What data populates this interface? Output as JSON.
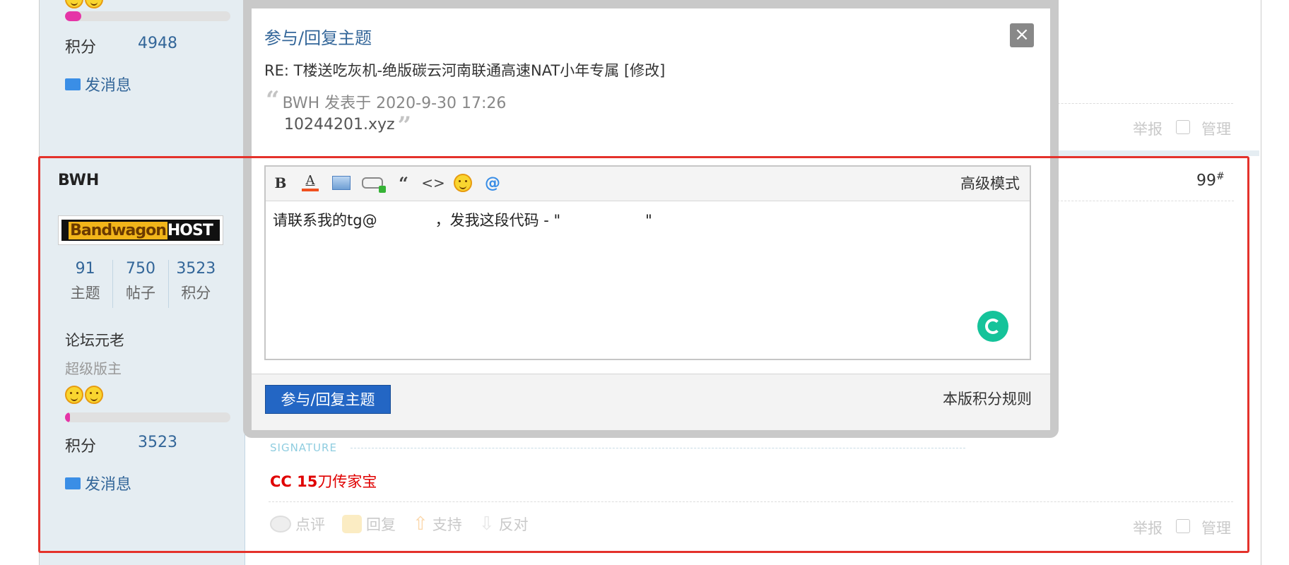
{
  "prev_post": {
    "score_label": "积分",
    "score_value": "4948",
    "message_link": "发消息",
    "report": "举报",
    "manage": "管理",
    "progress": 0.1
  },
  "post": {
    "username": "BWH",
    "logo_text": "BandwagonHOST",
    "stats": [
      {
        "value": "91",
        "label": "主题"
      },
      {
        "value": "750",
        "label": "帖子"
      },
      {
        "value": "3523",
        "label": "积分"
      }
    ],
    "rank": "论坛元老",
    "group": "超级版主",
    "progress": 0.02,
    "score_label": "积分",
    "score_value": "3523",
    "message_link": "发消息",
    "floor_number": "99",
    "floor_symbol": "#",
    "signature_label": "SIGNATURE",
    "signature_bold": "CC 15",
    "signature_rest": "刀传家宝",
    "actions": {
      "comment": "点评",
      "reply": "回复",
      "support": "支持",
      "oppose": "反对"
    },
    "report": "举报",
    "manage": "管理"
  },
  "modal": {
    "title": "参与/回复主题",
    "close": "×",
    "subject": "RE: T楼送吃灰机-绝版碳云河南联通高速NAT小年专属 [修改]",
    "quote_line1": "BWH 发表于 2020-9-30 17:26",
    "quote_line2": "10244201.xyz",
    "toolbar": {
      "bold": "B",
      "font_color": "A",
      "quote": "“",
      "code": "<>",
      "at": "@",
      "advanced_mode": "高级模式"
    },
    "editor_text_part1": "请联系我的tg@",
    "editor_text_part2": "，发我这段代码 - \"",
    "editor_text_part3": "\"",
    "submit": "参与/回复主题",
    "rules": "本版积分规则"
  },
  "colors": {
    "link": "#336699",
    "sidebar": "#e5edf2",
    "submit": "#2366c4",
    "annotation": "#e4322b",
    "signature": "#e00000"
  }
}
